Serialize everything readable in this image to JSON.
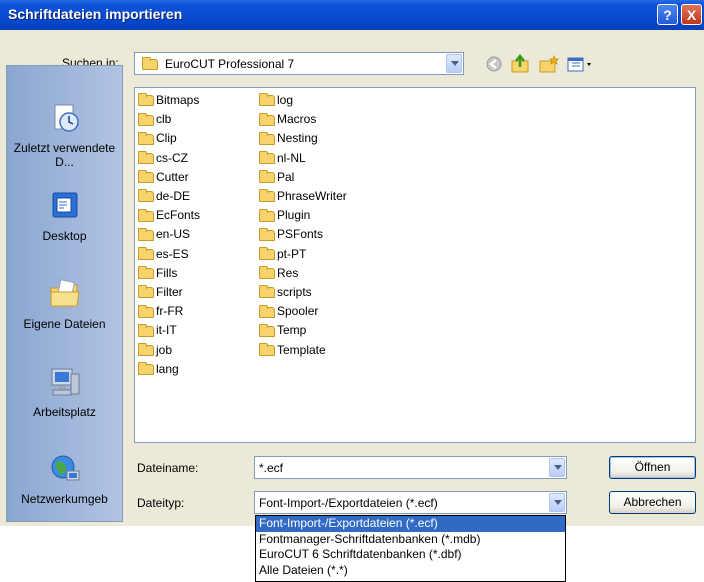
{
  "window": {
    "title": "Schriftdateien importieren",
    "help_label": "?",
    "close_label": "X"
  },
  "lookin": {
    "label": "Suchen in:",
    "value": "EuroCUT Professional 7"
  },
  "places": [
    {
      "label": "Zuletzt verwendete D...",
      "icon": "recent-documents-icon"
    },
    {
      "label": "Desktop",
      "icon": "desktop-icon"
    },
    {
      "label": "Eigene Dateien",
      "icon": "my-documents-icon"
    },
    {
      "label": "Arbeitsplatz",
      "icon": "my-computer-icon"
    },
    {
      "label": "Netzwerkumgeb",
      "icon": "network-icon"
    }
  ],
  "folders_col1": [
    "Bitmaps",
    "clb",
    "Clip",
    "cs-CZ",
    "Cutter",
    "de-DE",
    "EcFonts",
    "en-US",
    "es-ES",
    "Fills",
    "Filter",
    "fr-FR",
    "it-IT",
    "job",
    "lang"
  ],
  "folders_col2": [
    "log",
    "Macros",
    "Nesting",
    "nl-NL",
    "Pal",
    "PhraseWriter",
    "Plugin",
    "PSFonts",
    "pt-PT",
    "Res",
    "scripts",
    "Spooler",
    "Temp",
    "Template"
  ],
  "filename": {
    "label": "Dateiname:",
    "value": "*.ecf"
  },
  "filetype": {
    "label": "Dateityp:",
    "value": "Font-Import-/Exportdateien (*.ecf)"
  },
  "buttons": {
    "open": "Öffnen",
    "cancel": "Abbrechen"
  },
  "filetype_options": [
    "Font-Import-/Exportdateien (*.ecf)",
    "Fontmanager-Schriftdatenbanken (*.mdb)",
    "EuroCUT 6 Schriftdatenbanken (*.dbf)",
    "Alle Dateien (*.*)"
  ],
  "colors": {
    "titlebar": "#0a4bd0",
    "selection": "#316ac5",
    "dialog_bg": "#ece9d8"
  }
}
